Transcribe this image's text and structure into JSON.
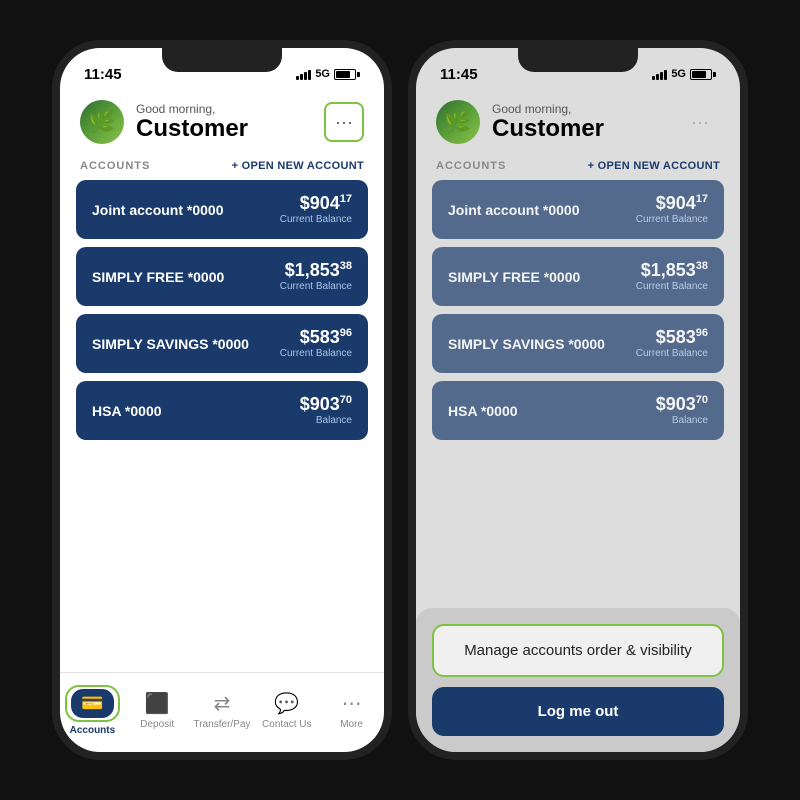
{
  "phone1": {
    "status_time": "11:45",
    "signal_label": "5G",
    "greeting_sub": "Good morning,",
    "greeting_name": "Customer",
    "more_dots": "···",
    "accounts_label": "ACCOUNTS",
    "open_new_account": "+ OPEN NEW ACCOUNT",
    "accounts": [
      {
        "name": "Joint account *0000",
        "balance": "$904",
        "cents": "17",
        "balance_label": "Current Balance"
      },
      {
        "name": "SIMPLY FREE *0000",
        "balance": "$1,853",
        "cents": "38",
        "balance_label": "Current Balance"
      },
      {
        "name": "SIMPLY SAVINGS *0000",
        "balance": "$583",
        "cents": "96",
        "balance_label": "Current Balance"
      },
      {
        "name": "HSA *0000",
        "balance": "$903",
        "cents": "70",
        "balance_label": "Balance"
      }
    ],
    "nav": [
      {
        "label": "Accounts",
        "icon": "💳",
        "active": true
      },
      {
        "label": "Deposit",
        "icon": "🏦",
        "active": false
      },
      {
        "label": "Transfer/Pay",
        "icon": "↔️",
        "active": false
      },
      {
        "label": "Contact Us",
        "icon": "💬",
        "active": false
      },
      {
        "label": "More",
        "icon": "⚏",
        "active": false
      }
    ]
  },
  "phone2": {
    "status_time": "11:45",
    "signal_label": "5G",
    "greeting_sub": "Good morning,",
    "greeting_name": "Customer",
    "more_dots": "···",
    "accounts_label": "ACCOUNTS",
    "open_new_account": "+ OPEN NEW ACCOUNT",
    "accounts": [
      {
        "name": "Joint account *0000",
        "balance": "$904",
        "cents": "17",
        "balance_label": "Current Balance"
      },
      {
        "name": "SIMPLY FREE *0000",
        "balance": "$1,853",
        "cents": "38",
        "balance_label": "Current Balance"
      },
      {
        "name": "SIMPLY SAVINGS *0000",
        "balance": "$583",
        "cents": "96",
        "balance_label": "Current Balance"
      },
      {
        "name": "HSA *0000",
        "balance": "$903",
        "cents": "70",
        "balance_label": "Balance"
      }
    ],
    "manage_label": "Manage accounts order & visibility",
    "logout_label": "Log me out"
  },
  "colors": {
    "brand_blue": "#1a3a6b",
    "green_highlight": "#7dc242"
  }
}
